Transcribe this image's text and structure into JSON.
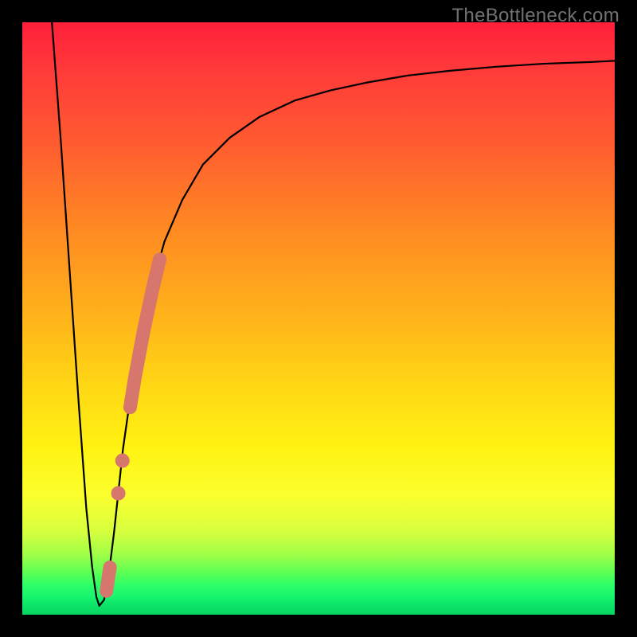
{
  "domain": "Chart",
  "watermark": "TheBottleneck.com",
  "colors": {
    "frame": "#000000",
    "gradient_top": "#ff1f3a",
    "gradient_bottom": "#07d460",
    "curve": "#000000",
    "markers": "#d6766d"
  },
  "chart_data": {
    "type": "line",
    "title": "",
    "xlabel": "",
    "ylabel": "",
    "xlim": [
      0,
      100
    ],
    "ylim": [
      0,
      100
    ],
    "note": "No axes or tick labels are displayed; values are estimated from pixel positions on the gradient heatmap background. Y is plotted with 100 at top, 0 at bottom.",
    "series": [
      {
        "name": "curve",
        "x": [
          5.0,
          6.5,
          8.0,
          9.5,
          10.8,
          11.8,
          12.5,
          13.0,
          13.8,
          14.5,
          15.5,
          17.0,
          19.0,
          21.5,
          24.0,
          27.0,
          30.5,
          35.0,
          40.0,
          46.0,
          52.0,
          58.0,
          65.0,
          72.0,
          80.0,
          88.0,
          96.0,
          100.0
        ],
        "y": [
          100.0,
          80.0,
          58.0,
          36.0,
          18.0,
          8.0,
          3.0,
          1.5,
          2.5,
          6.0,
          14.0,
          28.0,
          42.0,
          54.0,
          63.0,
          70.0,
          76.0,
          80.5,
          84.0,
          86.8,
          88.5,
          89.8,
          91.0,
          91.8,
          92.5,
          93.0,
          93.3,
          93.5
        ]
      }
    ],
    "markers": {
      "description": "Highlighted salmon-colored data points along the rising limb of the curve. Segments are rendered as thick rounded strokes; small gaps appear between groups.",
      "points": [
        {
          "x": 14.2,
          "y": 4.0
        },
        {
          "x": 14.8,
          "y": 8.0
        },
        {
          "x": 16.2,
          "y": 20.5
        },
        {
          "x": 16.9,
          "y": 26.0
        },
        {
          "x": 18.2,
          "y": 35.0
        },
        {
          "x": 19.0,
          "y": 40.0
        },
        {
          "x": 20.5,
          "y": 48.0
        },
        {
          "x": 22.0,
          "y": 55.0
        },
        {
          "x": 23.2,
          "y": 60.0
        }
      ]
    }
  }
}
